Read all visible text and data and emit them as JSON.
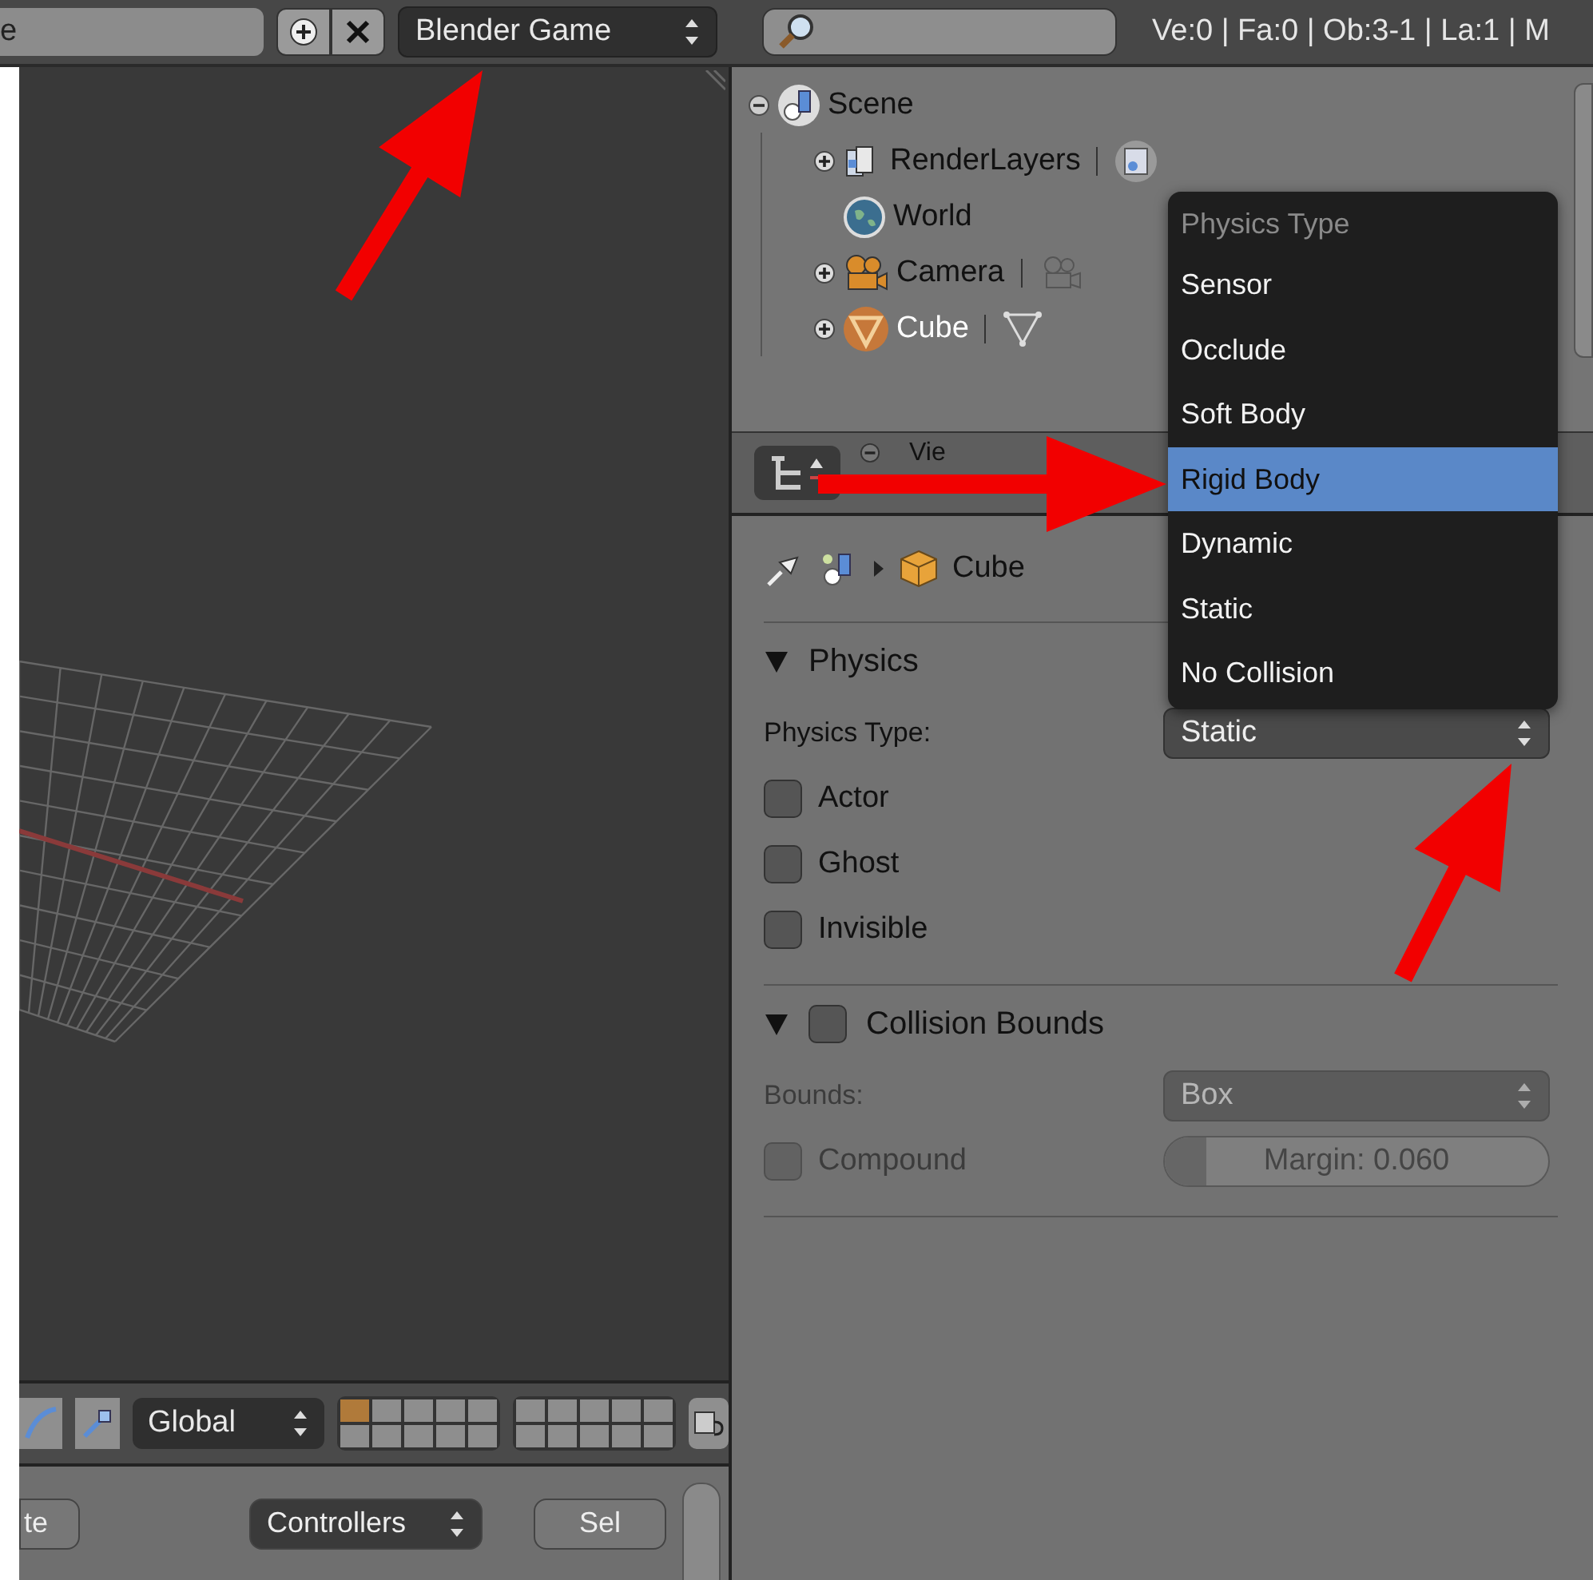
{
  "top_bar": {
    "file_field": "e",
    "engine_selector": "Blender Game",
    "stats": "Ve:0 | Fa:0 | Ob:3-1 | La:1 | M"
  },
  "viewport": {
    "header": {
      "orientation": "Global"
    }
  },
  "logic_editor": {
    "buttons": [
      {
        "label": "te",
        "kind": "button"
      },
      {
        "label": "Controllers",
        "kind": "dropdown"
      },
      {
        "label": "Sel",
        "kind": "button"
      }
    ]
  },
  "outliner": {
    "tree": [
      {
        "label": "Scene",
        "kind": "scene",
        "expanded": true,
        "selected": false,
        "children": [
          {
            "label": "RenderLayers",
            "kind": "render_layers",
            "expanded": false,
            "selected": false
          },
          {
            "label": "World",
            "kind": "world",
            "selected": false
          },
          {
            "label": "Camera",
            "kind": "camera",
            "expanded": false,
            "selected": false
          },
          {
            "label": "Cube",
            "kind": "mesh",
            "expanded": false,
            "selected": true
          }
        ]
      }
    ],
    "header": {
      "view_menu": "Vie"
    }
  },
  "properties": {
    "breadcrumb": "Cube",
    "panels": [
      {
        "title": "Physics",
        "expanded": true,
        "rows": [
          {
            "kind": "dropdown",
            "label": "Physics Type:",
            "value": "Static",
            "disabled": false
          },
          {
            "kind": "checkbox",
            "label": "Actor",
            "checked": false,
            "disabled": false
          },
          {
            "kind": "checkbox",
            "label": "Ghost",
            "checked": false,
            "disabled": false
          },
          {
            "kind": "checkbox",
            "label": "Invisible",
            "checked": false,
            "disabled": false
          }
        ]
      },
      {
        "title": "Collision Bounds",
        "expanded": true,
        "checkbox": {
          "checked": false
        },
        "rows": [
          {
            "kind": "dropdown",
            "label": "Bounds:",
            "value": "Box",
            "disabled": true
          },
          {
            "kind": "checkbox_slider",
            "label": "Compound",
            "checked": false,
            "disabled": true,
            "slider": {
              "text": "Margin: 0.060",
              "level": 0.11
            }
          }
        ]
      }
    ]
  },
  "physics_menu": {
    "title": "Physics Type",
    "items": [
      {
        "label": "Sensor",
        "selected": false
      },
      {
        "label": "Occlude",
        "selected": false
      },
      {
        "label": "Soft Body",
        "selected": false
      },
      {
        "label": "Rigid Body",
        "selected": true
      },
      {
        "label": "Dynamic",
        "selected": false
      },
      {
        "label": "Static",
        "selected": false
      },
      {
        "label": "No Collision",
        "selected": false
      }
    ]
  }
}
